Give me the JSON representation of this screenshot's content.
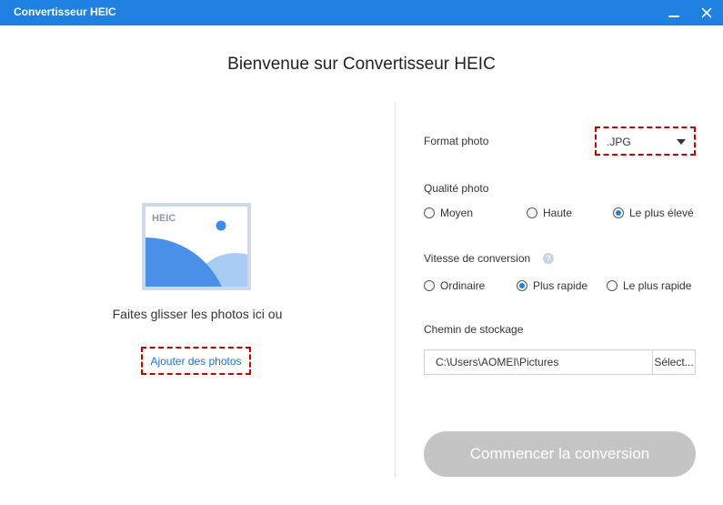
{
  "window": {
    "title": "Convertisseur HEIC",
    "titlebar_color": "#1e80e0",
    "controls": [
      "minimize-icon",
      "close-icon"
    ]
  },
  "main": {
    "title": "Bienvenue sur Convertisseur HEIC"
  },
  "left": {
    "illustration_badge": "HEIC",
    "drop_text": "Faites glisser les photos ici ou",
    "add_button": "Ajouter des photos"
  },
  "right": {
    "format": {
      "label": "Format photo",
      "value": ".JPG"
    },
    "quality": {
      "label": "Qualité photo",
      "options": [
        "Moyen",
        "Haute",
        "Le plus élevé"
      ],
      "selected": "Le plus élevé"
    },
    "speed": {
      "label": "Vitesse de conversion",
      "help_icon": "?",
      "options": [
        "Ordinaire",
        "Plus rapide",
        "Le plus rapide"
      ],
      "selected": "Plus rapide"
    },
    "storage": {
      "label": "Chemin de stockage",
      "path": "C:\\Users\\AOMEI\\Pictures",
      "browse": "Sélect..."
    },
    "start_button": "Commencer la conversion"
  },
  "colors": {
    "accent": "#1e80e0",
    "highlight_dash": "#cc0000",
    "start_disabled": "#c4c4c4",
    "link": "#1e6fd0"
  }
}
